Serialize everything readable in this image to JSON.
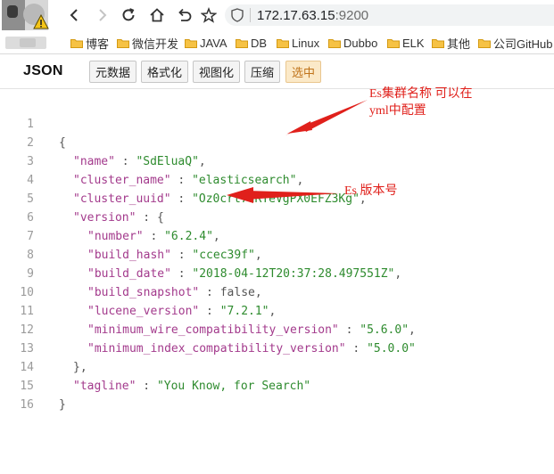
{
  "browser": {
    "url_host": "172.17.63.15",
    "url_port": ":9200",
    "bookmarks": [
      "博客",
      "微信开发",
      "JAVA",
      "DB",
      "Linux",
      "Dubbo",
      "ELK",
      "其他",
      "公司GitHub"
    ]
  },
  "viewer": {
    "title": "JSON",
    "buttons": [
      "元数据",
      "格式化",
      "视图化",
      "压缩",
      "选中"
    ],
    "active_button": "选中"
  },
  "code": {
    "line_numbers": [
      "1",
      "2",
      "3",
      "4",
      "5",
      "6",
      "7",
      "8",
      "9",
      "10",
      "11",
      "12",
      "13",
      "14",
      "15",
      "16"
    ],
    "l1": "{",
    "name_key": "\"name\"",
    "name_val": "\"SdEluaQ\"",
    "cluster_name_key": "\"cluster_name\"",
    "cluster_name_val": "\"elasticsearch\"",
    "cluster_uuid_key": "\"cluster_uuid\"",
    "cluster_uuid_val": "\"Oz0crt7uRTeVgPX0EFZ3Kg\"",
    "version_key": "\"version\"",
    "version_open": "{",
    "number_key": "\"number\"",
    "number_val": "\"6.2.4\"",
    "build_hash_key": "\"build_hash\"",
    "build_hash_val": "\"ccec39f\"",
    "build_date_key": "\"build_date\"",
    "build_date_val": "\"2018-04-12T20:37:28.497551Z\"",
    "build_snapshot_key": "\"build_snapshot\"",
    "build_snapshot_val": "false",
    "lucene_version_key": "\"lucene_version\"",
    "lucene_version_val": "\"7.2.1\"",
    "min_wire_key": "\"minimum_wire_compatibility_version\"",
    "min_wire_val": "\"5.6.0\"",
    "min_index_key": "\"minimum_index_compatibility_version\"",
    "min_index_val": "\"5.0.0\"",
    "version_close": "},",
    "tagline_key": "\"tagline\"",
    "tagline_val": "\"You Know, for Search\"",
    "l15": "}",
    "colon": " : ",
    "comma": ","
  },
  "annotations": {
    "cluster_note_1": "Es集群名称 可以在",
    "cluster_note_2": "yml中配置",
    "version_note": "Es 版本号"
  },
  "colors": {
    "key": "#a33a8c",
    "string": "#2e8b2e",
    "annotation": "#e0201b",
    "active_button_bg": "#fbe9c8"
  }
}
